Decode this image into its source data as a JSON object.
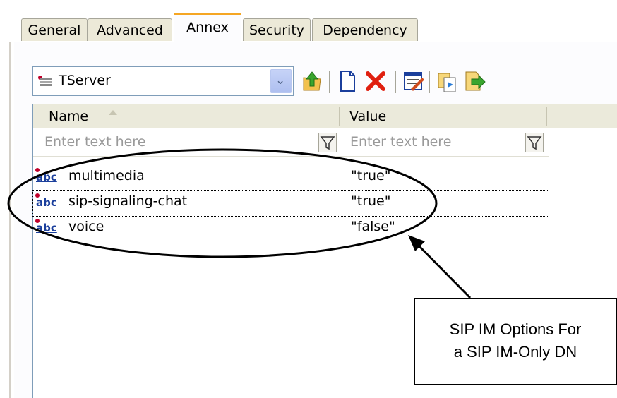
{
  "tabs": [
    {
      "label": "General",
      "active": false
    },
    {
      "label": "Advanced",
      "active": false
    },
    {
      "label": "Annex",
      "active": true
    },
    {
      "label": "Security",
      "active": false
    },
    {
      "label": "Dependency",
      "active": false
    }
  ],
  "toolbar": {
    "section_select_value": "TServer",
    "buttons": [
      "up-folder-icon",
      "new-document-icon",
      "delete-icon",
      "edit-icon",
      "copy-icon",
      "export-icon"
    ]
  },
  "grid": {
    "columns": [
      {
        "label": "Name",
        "sort": "ascending"
      },
      {
        "label": "Value"
      }
    ],
    "filters": {
      "name_placeholder": "Enter text here",
      "value_placeholder": "Enter text here"
    },
    "type_icon_label": "abc",
    "rows": [
      {
        "name": "multimedia",
        "value": "\"true\"",
        "selected": false
      },
      {
        "name": "sip-signaling-chat",
        "value": "\"true\"",
        "selected": true
      },
      {
        "name": "voice",
        "value": "\"false\"",
        "selected": false
      }
    ]
  },
  "annotation": {
    "line1": "SIP IM Options For",
    "line2": "a SIP IM-Only DN"
  },
  "colors": {
    "active_tab_accent": "#f5a623",
    "delete_red": "#e02010",
    "icon_blue": "#1b3f9c"
  }
}
